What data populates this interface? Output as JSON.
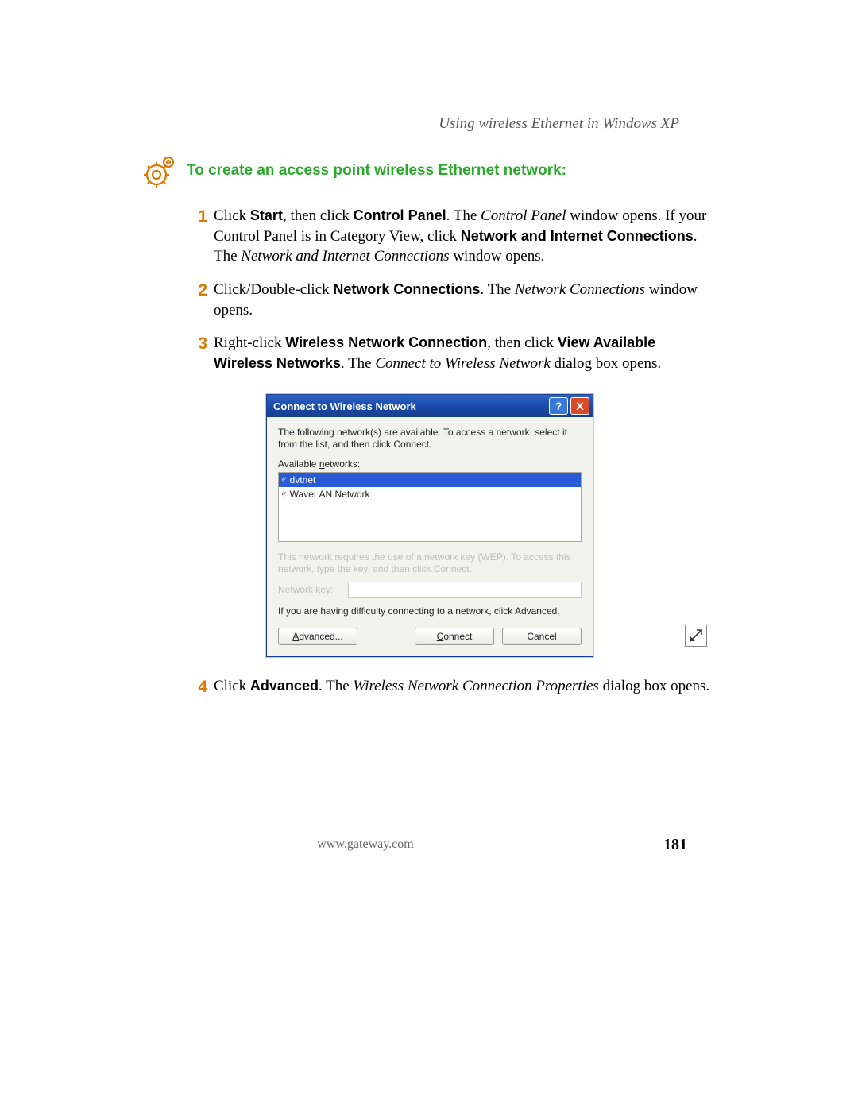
{
  "header": {
    "running": "Using wireless Ethernet in Windows XP"
  },
  "section": {
    "title": "To create an access point wireless Ethernet network:"
  },
  "steps": {
    "s1": {
      "num": "1",
      "t1": "Click ",
      "b1": "Start",
      "t2": ", then click ",
      "b2": "Control Panel",
      "t3": ". The ",
      "i1": "Control Panel",
      "t4": " window opens. If your Control Panel is in Category View, click ",
      "b3": "Network and Internet Connections",
      "t5": ". The ",
      "i2": "Network and Internet Connections",
      "t6": " window opens."
    },
    "s2": {
      "num": "2",
      "t1": "Click/Double-click ",
      "b1": "Network Connections",
      "t2": ". The ",
      "i1": "Network Connections",
      "t3": " window opens."
    },
    "s3": {
      "num": "3",
      "t1": "Right-click ",
      "b1": "Wireless Network Connection",
      "t2": ", then click ",
      "b2": "View Available Wireless Networks",
      "t3": ". The ",
      "i1": "Connect to Wireless Network",
      "t4": " dialog box opens."
    },
    "s4": {
      "num": "4",
      "t1": "Click ",
      "b1": "Advanced",
      "t2": ". The ",
      "i1": "Wireless Network Connection Properties",
      "t3": " dialog box opens."
    }
  },
  "dialog": {
    "title": "Connect to Wireless Network",
    "intro": "The following network(s) are available. To access a network, select it from the list, and then click Connect.",
    "available_label": "Available networks:",
    "networks": {
      "n0": "dvtnet",
      "n1": "WaveLAN Network"
    },
    "wep_note": "This network requires the use of a network key (WEP). To access this network, type the key, and then click Connect.",
    "key_label": "Network key:",
    "difficulty": "If you are having difficulty connecting to a network, click Advanced.",
    "buttons": {
      "advanced": "Advanced...",
      "connect": "Connect",
      "cancel": "Cancel"
    },
    "titlebar_help": "?",
    "titlebar_close": "X"
  },
  "footer": {
    "url": "www.gateway.com",
    "page": "181"
  }
}
